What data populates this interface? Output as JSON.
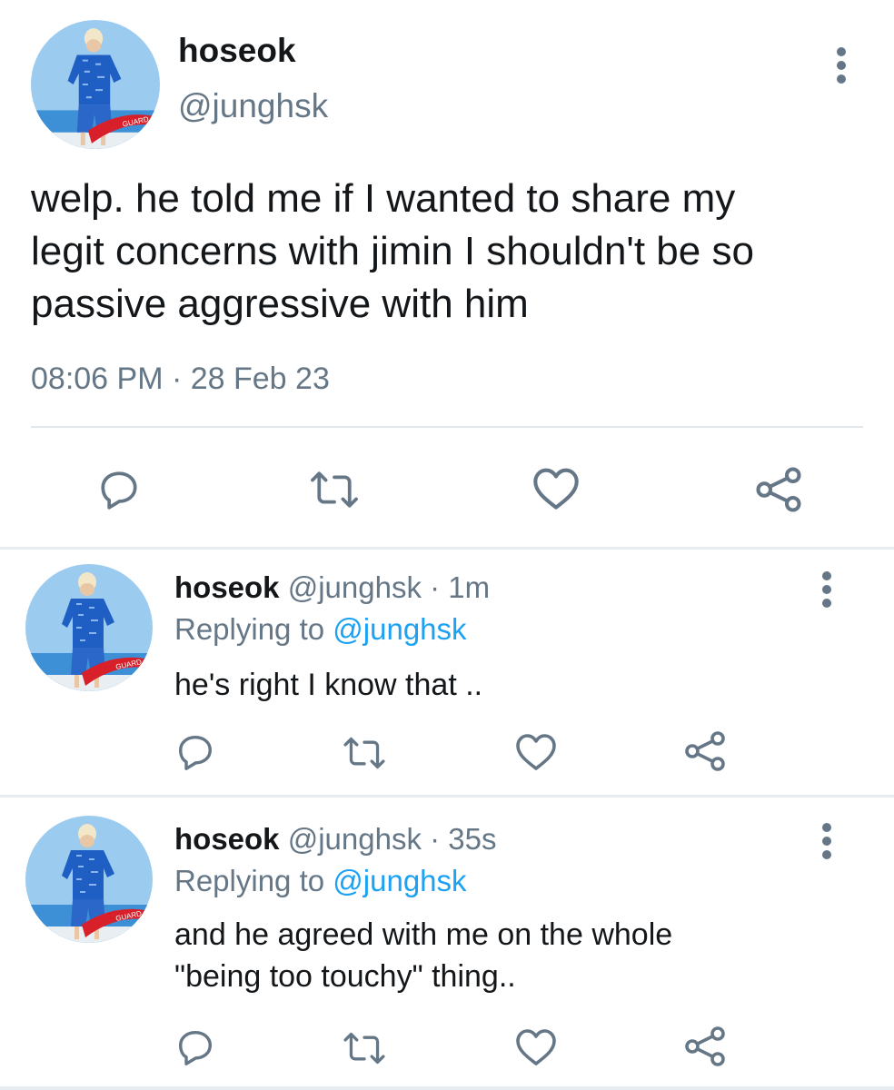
{
  "main_tweet": {
    "display_name": "hoseok",
    "handle": "@junghsk",
    "text": "welp. he told me if I wanted to share my\nlegit concerns with jimin I shouldn't be so\npassive aggressive with him",
    "timestamp": "08:06 PM · 28 Feb 23",
    "actions": [
      "reply-icon",
      "retweet-icon",
      "like-icon",
      "share-icon"
    ]
  },
  "replies": [
    {
      "display_name": "hoseok",
      "meta": "@junghsk · 1m",
      "replying_label": "Replying to",
      "replying_handle": "@junghsk",
      "text": "he's right I know that .."
    },
    {
      "display_name": "hoseok",
      "meta": "@junghsk · 35s",
      "replying_label": "Replying to",
      "replying_handle": "@junghsk",
      "text": "and he agreed with me on the whole\n\"being too touchy\" thing.."
    }
  ],
  "colors": {
    "text": "#14171a",
    "muted": "#657786",
    "accent": "#1da1f2",
    "divider": "#e6ecf0",
    "avatar_sky": "#8fc6ee",
    "avatar_outfit": "#1f5fc4",
    "avatar_float": "#d8202a"
  }
}
